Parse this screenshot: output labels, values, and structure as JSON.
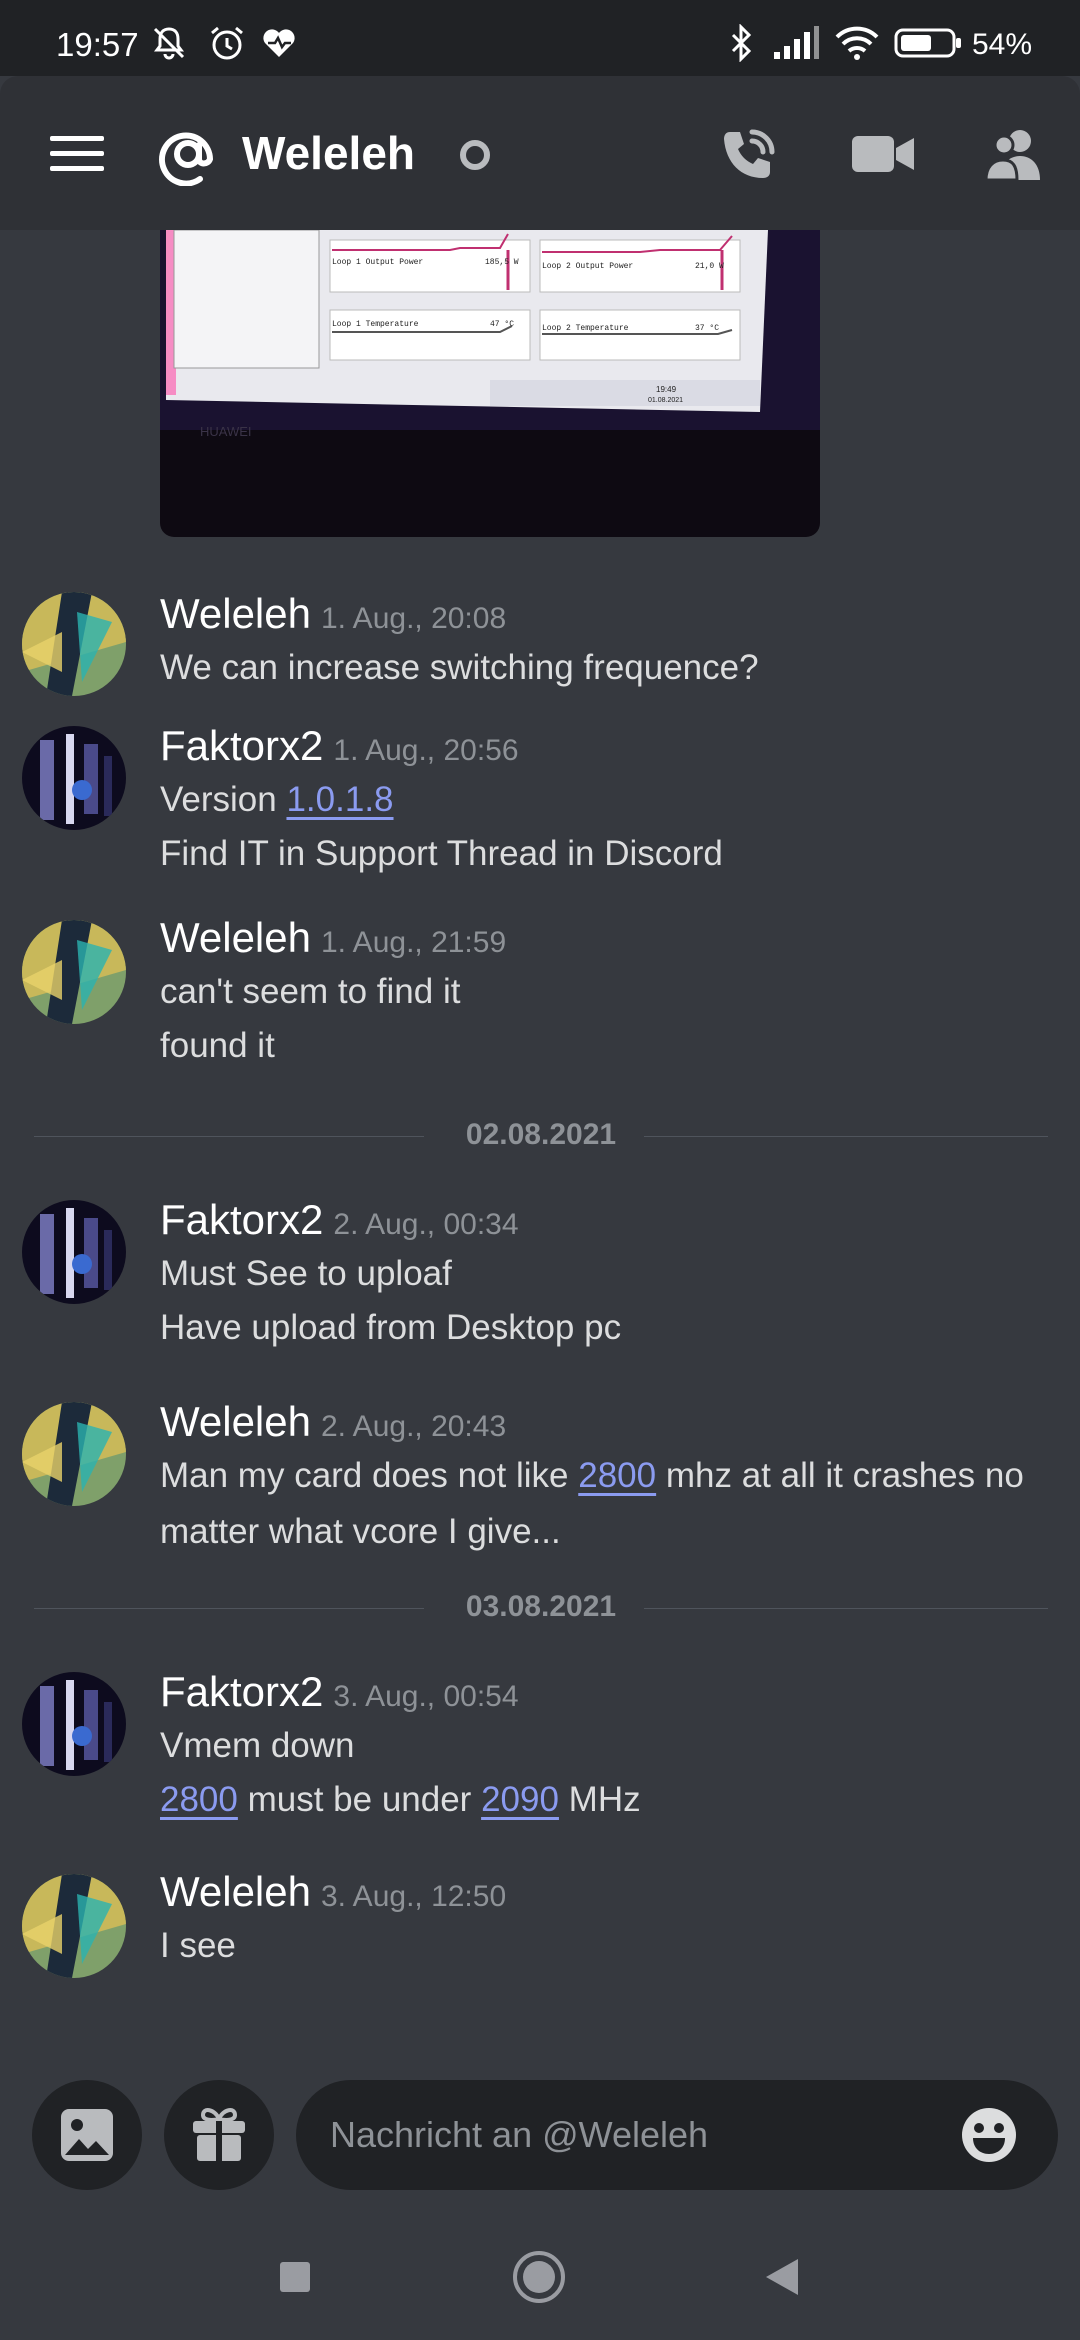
{
  "status_bar": {
    "time": "19:57",
    "battery": "54%"
  },
  "header": {
    "title": "Weleleh"
  },
  "dividers": [
    "02.08.2021",
    "03.08.2021"
  ],
  "messages": [
    {
      "author": "Weleleh",
      "timestamp": "1. Aug., 20:08",
      "lines": [
        "We can increase switching frequence?"
      ]
    },
    {
      "author": "Faktorx2",
      "timestamp": "1. Aug., 20:56",
      "line1_text": "Version ",
      "line1_link": "1.0.1.8",
      "line2": "Find IT in Support Thread in Discord"
    },
    {
      "author": "Weleleh",
      "timestamp": "1. Aug., 21:59",
      "lines": [
        "can't seem to find it",
        "found it"
      ]
    },
    {
      "author": "Faktorx2",
      "timestamp": "2. Aug., 00:34",
      "lines": [
        "Must See to uploaf",
        "Have upload from Desktop pc"
      ]
    },
    {
      "author": "Weleleh",
      "timestamp": "2. Aug., 20:43",
      "line1_pre": "Man my card does not like ",
      "line1_link": "2800",
      "line1_post": " mhz at all it crashes no",
      "line2": "matter what vcore I give..."
    },
    {
      "author": "Faktorx2",
      "timestamp": "3. Aug., 00:54",
      "line1": "Vmem down",
      "line2_link1": "2800",
      "line2_mid": " must be under ",
      "line2_link2": "2090",
      "line2_post": " MHz"
    },
    {
      "author": "Weleleh",
      "timestamp": "3. Aug., 12:50",
      "lines": [
        "I see"
      ]
    }
  ],
  "image_preview": {
    "labels": [
      "Loop 1 Output Power",
      "185,5 W",
      "Loop 2 Output Power",
      "21,0 W",
      "Loop 1 Temperature",
      "47 °C",
      "Loop 2 Temperature",
      "37 °C"
    ],
    "clock": "19:49",
    "date": "01.08.2021",
    "brand": "HUAWEI"
  },
  "composer": {
    "placeholder": "Nachricht an @Weleleh"
  },
  "icons": {
    "menu": "hamburger-menu-icon",
    "at": "at-sign-icon",
    "status": "offline-status-icon",
    "call": "phone-call-icon",
    "video": "video-camera-icon",
    "members": "members-icon",
    "gallery": "image-gallery-icon",
    "gift": "gift-icon",
    "emoji": "emoji-icon"
  },
  "colors": {
    "background": "#36393f",
    "header": "#2f3136",
    "input": "#202225",
    "link": "#8b9bf0",
    "muted": "#8e9297"
  }
}
